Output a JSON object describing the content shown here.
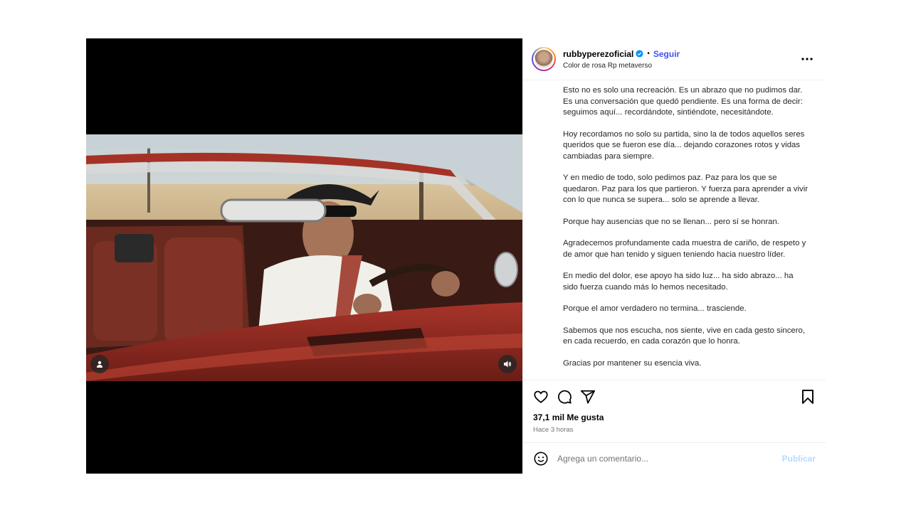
{
  "header": {
    "username": "rubbyperezoficial",
    "separator": "•",
    "follow_label": "Seguir",
    "subtitle": "Color de rosa Rp metaverso"
  },
  "caption": {
    "paragraphs": [
      "Esto no es solo una recreación. Es un abrazo que no pudimos dar. Es una conversación que quedó pendiente. Es una forma de decir: seguimos aquí... recordándote, sintiéndote, necesitándote.",
      "Hoy recordamos no solo su partida, sino la de todos aquellos seres queridos que se fueron ese día... dejando corazones rotos y vidas cambiadas para siempre.",
      "Y en medio de todo, solo pedimos paz. Paz para los que se quedaron. Paz para los que partieron. Y fuerza para aprender a vivir con lo que nunca se supera... solo se aprende a llevar.",
      "Porque hay ausencias que no se llenan... pero sí se honran.",
      "Agradecemos profundamente cada muestra de cariño, de respeto y de amor que han tenido y siguen teniendo hacia nuestro líder.",
      "En medio del dolor, ese apoyo ha sido luz... ha sido abrazo... ha sido fuerza cuando más lo hemos necesitado.",
      "Porque el amor verdadero no termina... trasciende.",
      "Sabemos que nos escucha, nos siente, vive en cada gesto sincero, en cada recuerdo, en cada corazón que lo honra.",
      "Gracias por mantener su esencia viva."
    ]
  },
  "stats": {
    "likes": "37,1 mil Me gusta",
    "time": "Hace 3 horas"
  },
  "comment": {
    "placeholder": "Agrega un comentario...",
    "publish_label": "Publicar"
  },
  "icons": {
    "verified": "verified-badge-icon",
    "more": "more-options-icon",
    "like": "heart-icon",
    "comment": "comment-icon",
    "share": "share-icon",
    "save": "bookmark-icon",
    "emoji": "emoji-icon",
    "tag": "user-tag-icon",
    "mute": "speaker-icon"
  },
  "colors": {
    "follow": "#4150f7",
    "publish": "#b3dbff",
    "verified": "#0095f6"
  }
}
